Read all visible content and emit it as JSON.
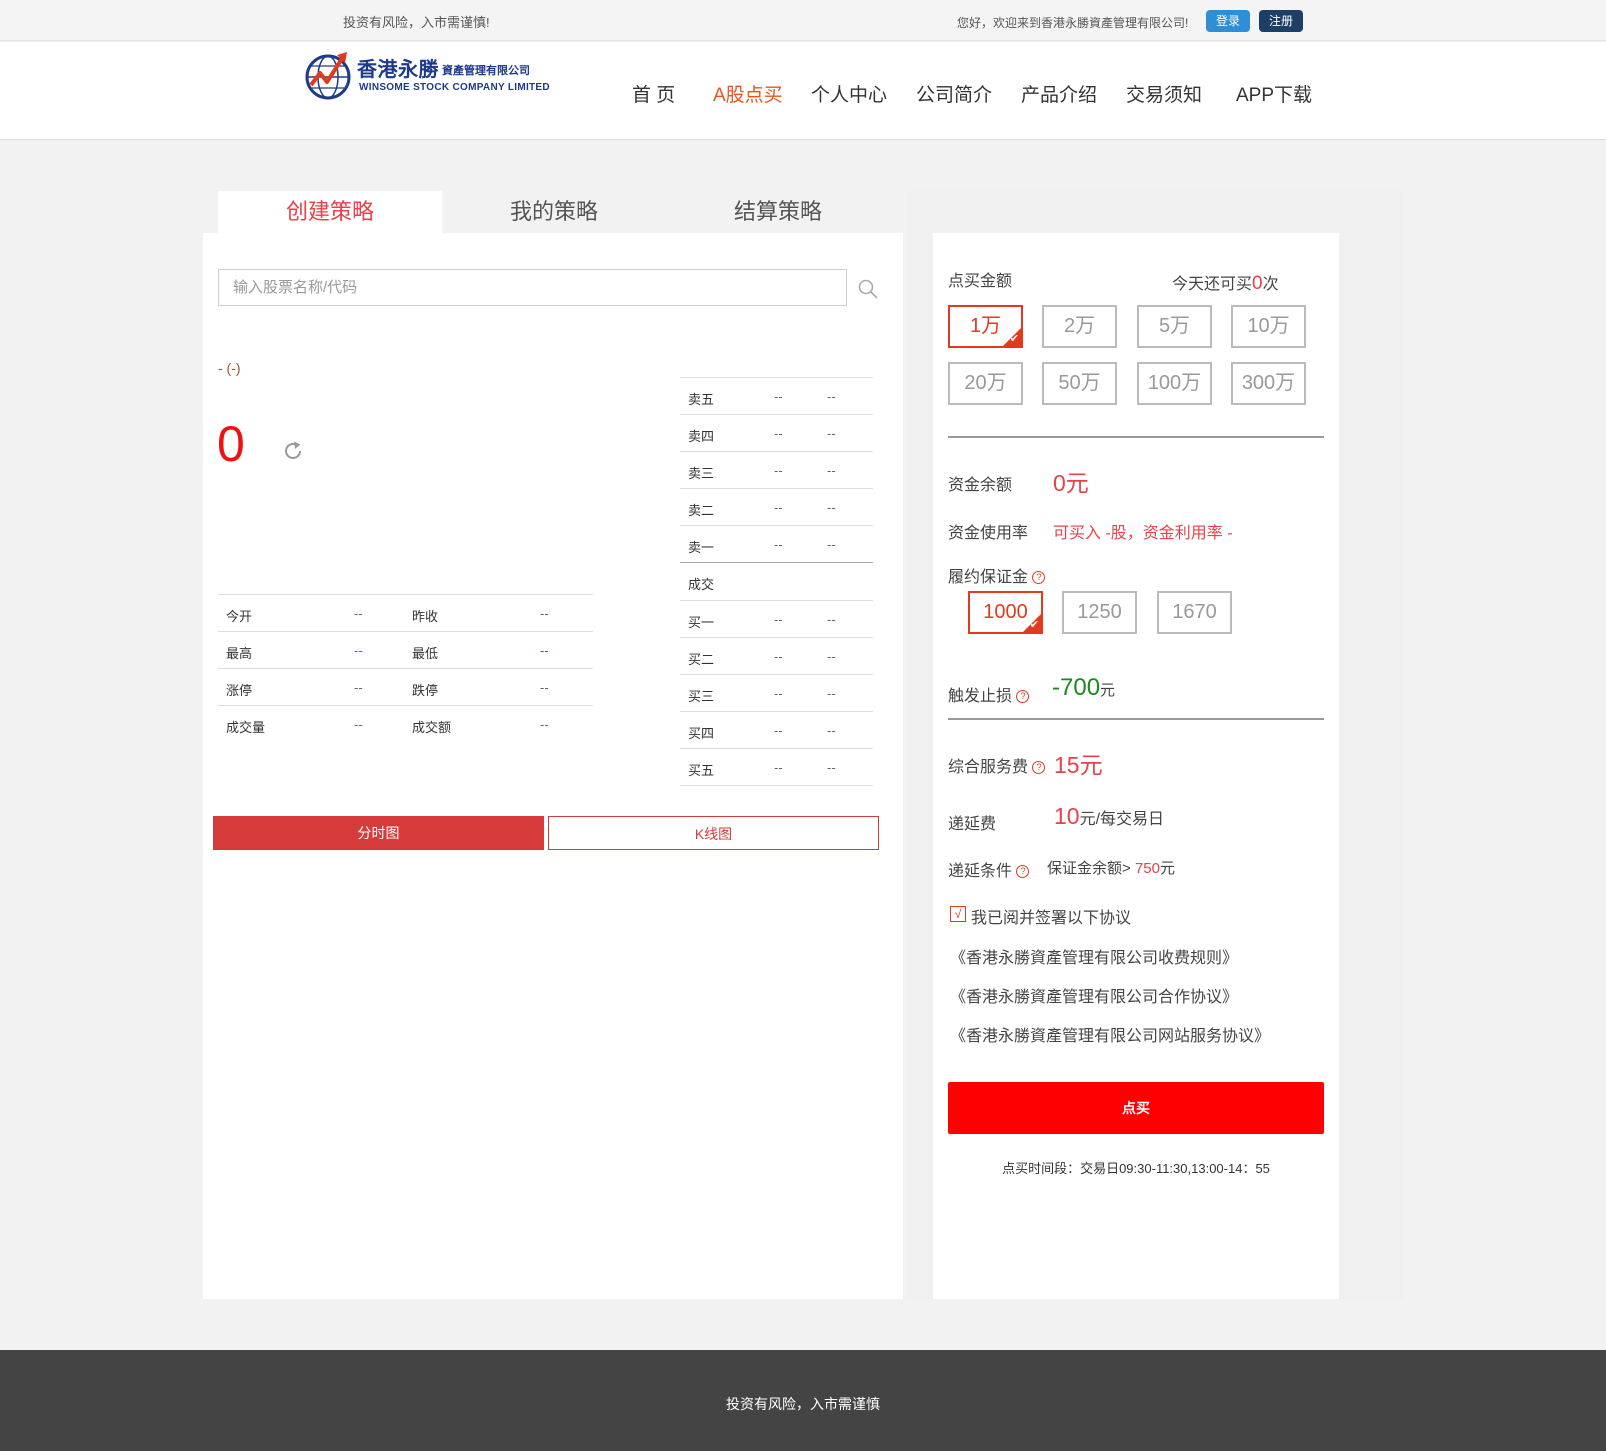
{
  "topbar": {
    "warning": "投资有风险，入市需谨慎!",
    "welcome": "您好，欢迎来到香港永勝資產管理有限公司!",
    "login_label": "登录",
    "register_label": "注册"
  },
  "logo": {
    "name_cn": "香港永勝",
    "name_cn_sub": "資產管理有限公司",
    "name_en": "WINSOME STOCK COMPANY LIMITED"
  },
  "nav": {
    "items": [
      "首 页",
      "A股点买",
      "个人中心",
      "公司简介",
      "产品介绍",
      "交易须知",
      "APP下载"
    ],
    "active_index": 1
  },
  "tabs": [
    "创建策略",
    "我的策略",
    "结算策略"
  ],
  "search": {
    "placeholder": "输入股票名称/代码",
    "value": ""
  },
  "stock": {
    "name_code": "- (-)",
    "price": "0",
    "stats": [
      {
        "l1": "今开",
        "v1": "--",
        "l2": "昨收",
        "v2": "--"
      },
      {
        "l1": "最高",
        "v1": "--",
        "l2": "最低",
        "v2": "--"
      },
      {
        "l1": "涨停",
        "v1": "--",
        "l2": "跌停",
        "v2": "--"
      },
      {
        "l1": "成交量",
        "v1": "--",
        "l2": "成交额",
        "v2": "--"
      }
    ]
  },
  "orderbook": {
    "sells": [
      {
        "label": "卖五",
        "price": "--",
        "volume": "--"
      },
      {
        "label": "卖四",
        "price": "--",
        "volume": "--"
      },
      {
        "label": "卖三",
        "price": "--",
        "volume": "--"
      },
      {
        "label": "卖二",
        "price": "--",
        "volume": "--"
      },
      {
        "label": "卖一",
        "price": "--",
        "volume": "--"
      }
    ],
    "trade_label": "成交",
    "buys": [
      {
        "label": "买一",
        "price": "--",
        "volume": "--"
      },
      {
        "label": "买二",
        "price": "--",
        "volume": "--"
      },
      {
        "label": "买三",
        "price": "--",
        "volume": "--"
      },
      {
        "label": "买四",
        "price": "--",
        "volume": "--"
      },
      {
        "label": "买五",
        "price": "--",
        "volume": "--"
      }
    ]
  },
  "chart_buttons": {
    "fenshi": "分时图",
    "kline": "K线图"
  },
  "order": {
    "amount_label": "点买金额",
    "remaining_prefix": "今天还可买",
    "remaining_count": "0",
    "remaining_suffix": "次",
    "amounts": [
      "1万",
      "2万",
      "5万",
      "10万",
      "20万",
      "50万",
      "100万",
      "300万"
    ],
    "amount_selected_index": 0,
    "balance_label": "资金余额",
    "balance_value": "0元",
    "usage_label": "资金使用率",
    "usage_value": "可买入 -股，资金利用率 -",
    "margin_label": "履约保证金",
    "margins": [
      "1000",
      "1250",
      "1670"
    ],
    "margin_selected_index": 0,
    "stoploss_label": "触发止损",
    "stoploss_value": "-700",
    "stoploss_unit": "元",
    "service_fee_label": "综合服务费",
    "service_fee_value": "15元",
    "deferral_fee_label": "递延费",
    "deferral_fee_value": "10",
    "deferral_fee_unit": "元/每交易日",
    "deferral_cond_label": "递延条件",
    "deferral_cond_text": "保证金余额>",
    "deferral_cond_value": "750",
    "deferral_cond_unit": "元",
    "agree_check": "√",
    "agree_text": "我已阅并签署以下协议",
    "agreements": [
      "《香港永勝資產管理有限公司收费规则》",
      "《香港永勝資產管理有限公司合作协议》",
      "《香港永勝資產管理有限公司网站服务协议》"
    ],
    "submit_label": "点买",
    "time_info": "点买时间段：交易日09:30-11:30,13:00-14：55"
  },
  "footer": {
    "text": "投资有风险，入市需谨慎"
  },
  "colors": {
    "accent_red": "#e8414a",
    "buy_button": "#fe0000",
    "nav_active": "#e8551b",
    "stoploss_green": "#1a8a1a",
    "login_blue": "#2e8ed6",
    "register_navy": "#1d3f66"
  }
}
